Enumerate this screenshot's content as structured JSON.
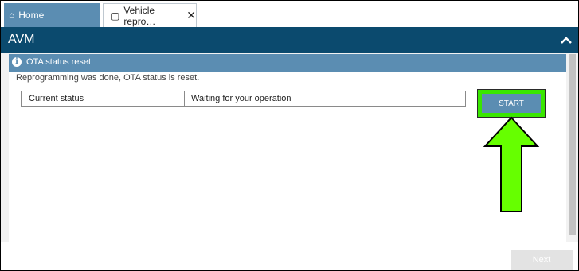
{
  "tabs": [
    {
      "label": "Home",
      "icon": "home-icon"
    },
    {
      "label": "Vehicle repro…",
      "icon": "tablet-icon",
      "close_icon": "close-icon"
    }
  ],
  "header": {
    "title": "AVM",
    "collapse_icon": "chevron-up-icon"
  },
  "section": {
    "title": "OTA status reset",
    "icon": "info-icon"
  },
  "content": {
    "description": "Reprogramming was done, OTA status is reset.",
    "status_label": "Current status",
    "status_value": "Waiting for your operation",
    "start_label": "START"
  },
  "footer": {
    "next_label": "Next"
  },
  "annotation": {
    "highlight_color": "#39e600",
    "arrow_color": "#66ff00"
  },
  "colors": {
    "header_bg": "#0b4a6e",
    "accent": "#5b8db2"
  }
}
